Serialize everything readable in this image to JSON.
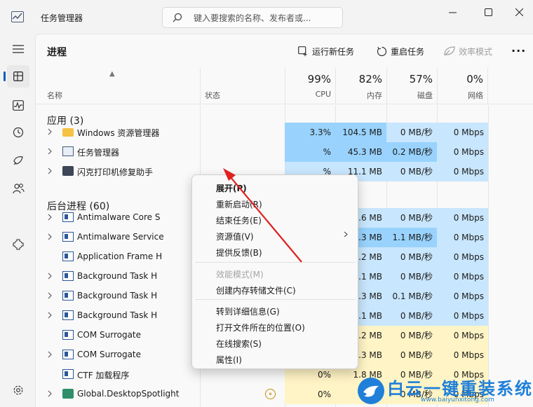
{
  "app": {
    "title": "任务管理器",
    "icon": "task-manager-icon"
  },
  "search": {
    "placeholder": "键入要搜索的名称、发布者或..."
  },
  "window_controls": [
    "minimize-icon",
    "maximize-icon",
    "close-icon"
  ],
  "sidebar": {
    "items": [
      {
        "name": "hamburger-menu-icon"
      },
      {
        "name": "processes-icon",
        "active": true
      },
      {
        "name": "performance-icon"
      },
      {
        "name": "app-history-icon"
      },
      {
        "name": "startup-apps-icon"
      },
      {
        "name": "users-icon"
      },
      {
        "name": "services-icon"
      }
    ],
    "settings": "settings-gear-icon"
  },
  "page": {
    "title": "进程"
  },
  "toolbar": {
    "run_new_task": "运行新任务",
    "restart_task": "重启任务",
    "efficiency_mode": "效率模式",
    "more": "···"
  },
  "columns": {
    "name": "名称",
    "status": "状态",
    "cpu": {
      "pct": "99%",
      "label": "CPU"
    },
    "memory": {
      "pct": "82%",
      "label": "内存"
    },
    "disk": {
      "pct": "57%",
      "label": "磁盘"
    },
    "network": {
      "pct": "0%",
      "label": "网络"
    }
  },
  "colors": {
    "heat_1": "#fff4c5",
    "heat_2": "#c8e6fd",
    "heat_3": "#99d3fd",
    "accent": "#005fb8"
  },
  "groups": {
    "apps": "应用 (3)",
    "background": "后台进程 (60)"
  },
  "rows": [
    {
      "name": "Windows 资源管理器",
      "cpu": "3.3%",
      "mem": "104.5 MB",
      "disk": "0 MB/秒",
      "net": "0 Mbps",
      "icon": "folder-icon"
    },
    {
      "name": "任务管理器",
      "cpu": "%",
      "mem": "45.3 MB",
      "disk": "0.2 MB/秒",
      "net": "0 Mbps",
      "icon": "task-manager-icon"
    },
    {
      "name": "闪克打印机修复助手",
      "cpu": "%",
      "mem": "11.1 MB",
      "disk": "0 MB/秒",
      "net": "0 Mbps",
      "icon": "printer-icon"
    },
    {
      "name": "Antimalware Core S",
      "cpu": "%",
      "mem": "7.6 MB",
      "disk": "0 MB/秒",
      "net": "0 Mbps",
      "icon": "service-icon"
    },
    {
      "name": "Antimalware Service",
      "cpu": "%",
      "mem": "153.3 MB",
      "disk": "1.1 MB/秒",
      "net": "0 Mbps",
      "icon": "service-icon"
    },
    {
      "name": "Application Frame H",
      "cpu": "%",
      "mem": "5.2 MB",
      "disk": "0 MB/秒",
      "net": "0 Mbps",
      "icon": "service-icon"
    },
    {
      "name": "Background Task H",
      "cpu": "%",
      "mem": "1.1 MB",
      "disk": "0 MB/秒",
      "net": "0 Mbps",
      "icon": "service-icon"
    },
    {
      "name": "Background Task H",
      "cpu": "%",
      "mem": "22.3 MB",
      "disk": "0.1 MB/秒",
      "net": "0 Mbps",
      "icon": "service-icon"
    },
    {
      "name": "Background Task H",
      "cpu": "%",
      "mem": "1.1 MB",
      "disk": "0 MB/秒",
      "net": "0 Mbps",
      "icon": "service-icon"
    },
    {
      "name": "COM Surrogate",
      "cpu": "0%",
      "mem": "2.2 MB",
      "disk": "0 MB/秒",
      "net": "0 Mbps",
      "icon": "service-icon"
    },
    {
      "name": "COM Surrogate",
      "cpu": "0%",
      "mem": "1.3 MB",
      "disk": "0 MB/秒",
      "net": "0 Mbps",
      "icon": "service-icon"
    },
    {
      "name": "CTF 加载程序",
      "cpu": "0%",
      "mem": "1.8 MB",
      "disk": "0 MB/秒",
      "net": "0 Mbps",
      "icon": "service-icon"
    },
    {
      "name": "Global.DesktopSpotlight",
      "cpu": "0%",
      "mem": "0 MB",
      "disk": "0 MB/秒",
      "net": "0 Mbps",
      "icon": "spotlight-icon"
    }
  ],
  "context_menu": {
    "items": [
      {
        "label": "展开(P)",
        "bold": true
      },
      {
        "label": "重新启动(R)"
      },
      {
        "label": "结束任务(E)"
      },
      {
        "label": "资源值(V)",
        "submenu": true
      },
      {
        "label": "提供反馈(B)"
      },
      {
        "label": "效能模式(M)",
        "disabled": true
      },
      {
        "label": "创建内存转储文件(C)"
      },
      {
        "label": "转到详细信息(G)"
      },
      {
        "label": "打开文件所在的位置(O)"
      },
      {
        "label": "在线搜索(S)"
      },
      {
        "label": "属性(I)"
      }
    ]
  },
  "watermark": {
    "text": "白云一键重装系统",
    "url": "www.baiyunxitong.com",
    "logo": "bird-logo-icon"
  }
}
